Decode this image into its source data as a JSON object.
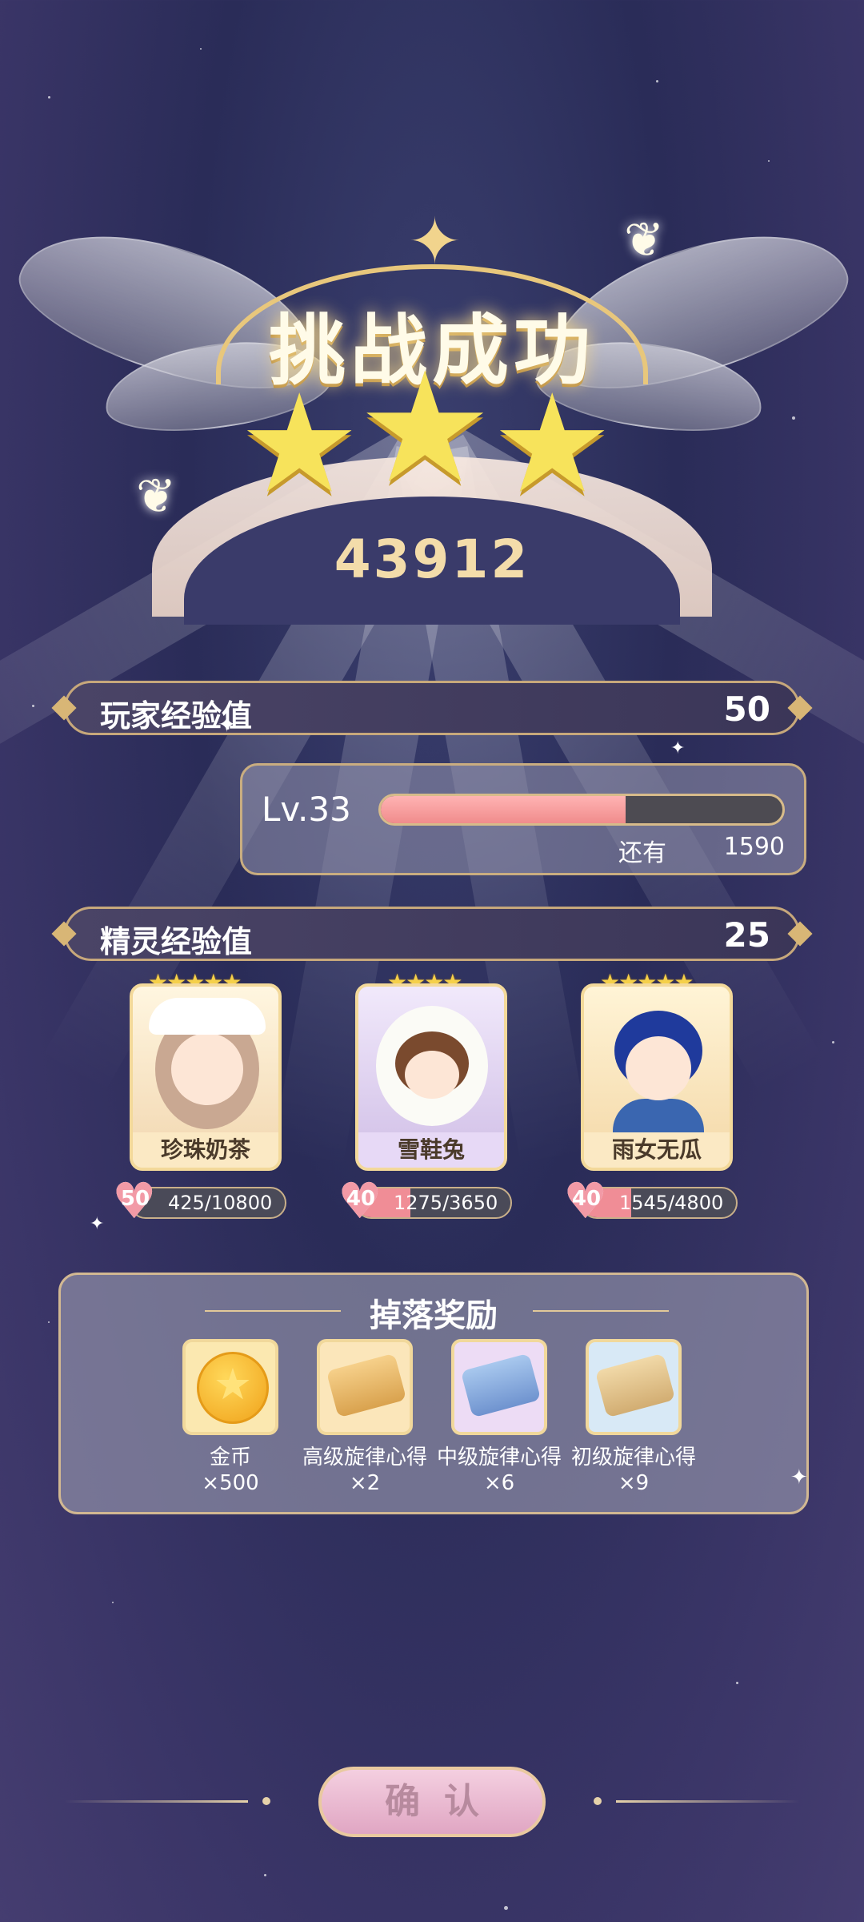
{
  "header": {
    "title": "挑战成功",
    "score": "43912",
    "stars": 3
  },
  "player_exp": {
    "label": "玩家经验值",
    "value": "50",
    "level": "Lv.33",
    "progress": 0.61,
    "remaining_label": "还有",
    "remaining_value": "1590"
  },
  "spirit_exp": {
    "label": "精灵经验值",
    "value": "25"
  },
  "spirits": [
    {
      "name": "珍珠奶茶",
      "stars": "★★★★★",
      "level": "50",
      "exp": "425/10800",
      "exp_progress": 0.04
    },
    {
      "name": "雪鞋兔",
      "stars": "★★★★",
      "level": "40",
      "exp": "1275/3650",
      "exp_progress": 0.35
    },
    {
      "name": "雨女无瓜",
      "stars": "★★★★★",
      "level": "40",
      "exp": "1545/4800",
      "exp_progress": 0.32
    }
  ],
  "rewards": {
    "title": "掉落奖励",
    "items": [
      {
        "name": "金币",
        "count": "×500",
        "icon": "coin-icon"
      },
      {
        "name": "高级旋律心得",
        "count": "×2",
        "icon": "scroll-gold-icon"
      },
      {
        "name": "中级旋律心得",
        "count": "×6",
        "icon": "scroll-blue-icon"
      },
      {
        "name": "初级旋律心得",
        "count": "×9",
        "icon": "scroll-tan-icon"
      }
    ]
  },
  "confirm_label": "确认",
  "colors": {
    "accent_gold": "#d8b676",
    "exp_fill": "#f08c8c",
    "button_pink": "#e0a6c3"
  }
}
